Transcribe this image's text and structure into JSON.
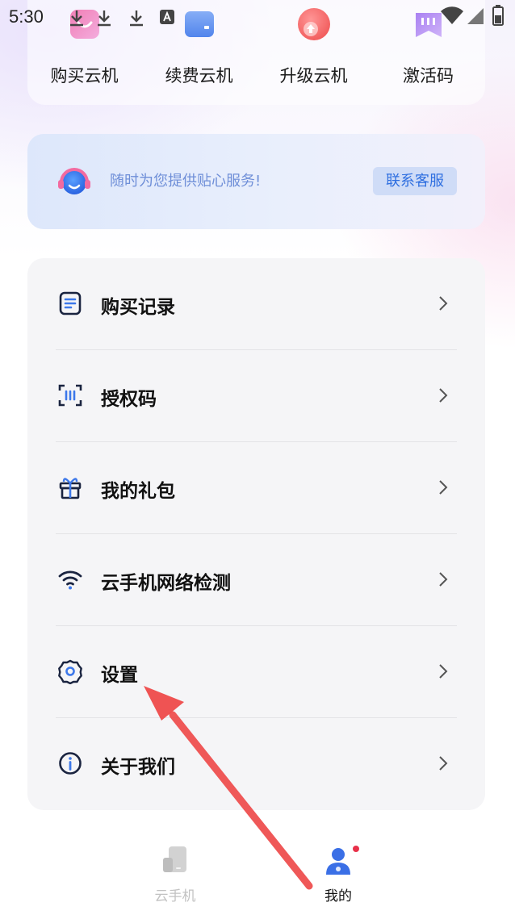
{
  "status_bar": {
    "time": "5:30",
    "icons": [
      "download-icon",
      "download-icon",
      "download-icon",
      "font-icon",
      "wifi-icon",
      "signal-icon",
      "battery-icon"
    ]
  },
  "quick_actions": [
    {
      "label": "购买云机",
      "icon": "purchase-cloud-icon"
    },
    {
      "label": "续费云机",
      "icon": "renew-cloud-icon"
    },
    {
      "label": "升级云机",
      "icon": "upgrade-cloud-icon"
    },
    {
      "label": "激活码",
      "icon": "activation-code-icon"
    }
  ],
  "service": {
    "text": "随时为您提供贴心服务!",
    "button": "联系客服",
    "icon": "customer-service-icon"
  },
  "menu": [
    {
      "label": "购买记录",
      "icon": "document-icon"
    },
    {
      "label": "授权码",
      "icon": "scan-code-icon"
    },
    {
      "label": "我的礼包",
      "icon": "gift-icon"
    },
    {
      "label": "云手机网络检测",
      "icon": "wifi-icon"
    },
    {
      "label": "设置",
      "icon": "gear-icon"
    },
    {
      "label": "关于我们",
      "icon": "info-icon"
    }
  ],
  "tabs": [
    {
      "label": "云手机",
      "active": false,
      "icon": "phone-icon"
    },
    {
      "label": "我的",
      "active": true,
      "icon": "user-icon",
      "badge_dot": true
    }
  ],
  "colors": {
    "accent_blue": "#2f6fe0",
    "annotation_arrow": "#ee4a4a",
    "inactive_tab": "#c8c8c8",
    "badge": "#e8314a"
  }
}
